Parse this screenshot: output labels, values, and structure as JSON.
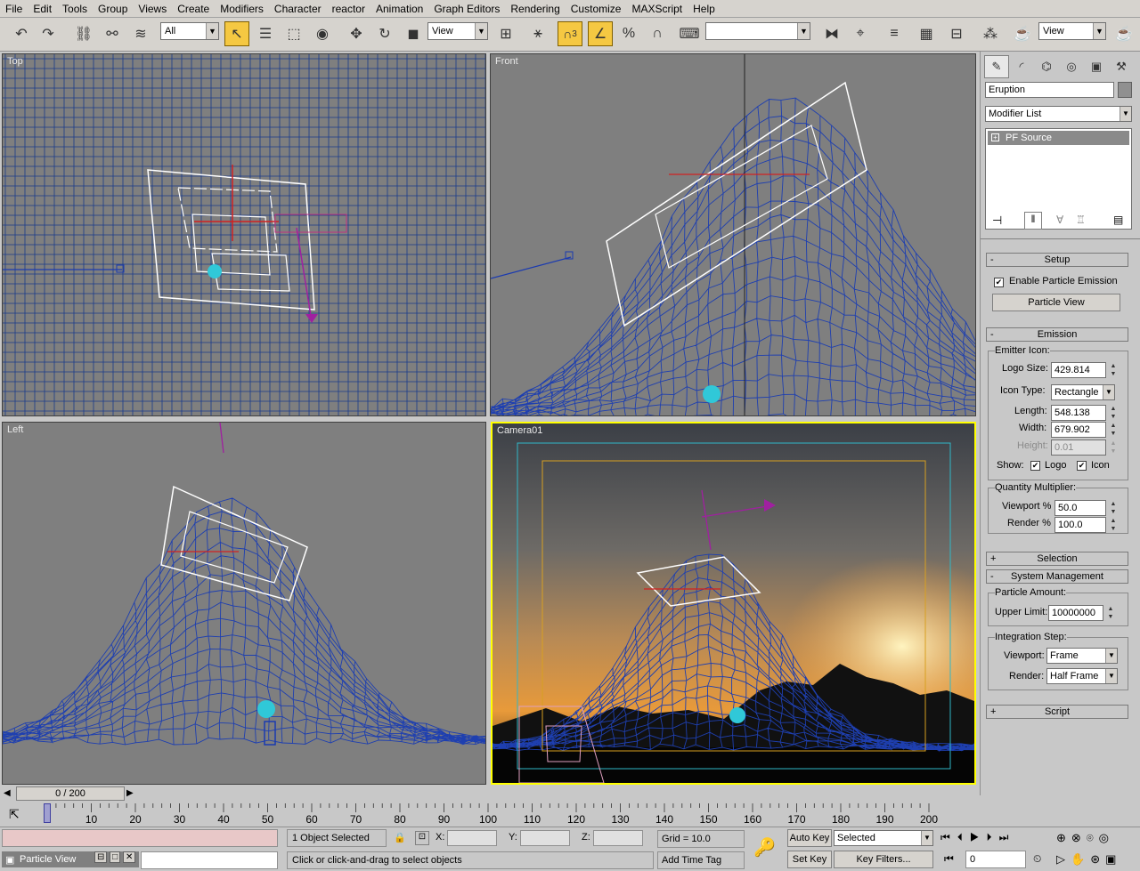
{
  "menu": [
    "File",
    "Edit",
    "Tools",
    "Group",
    "Views",
    "Create",
    "Modifiers",
    "Character",
    "reactor",
    "Animation",
    "Graph Editors",
    "Rendering",
    "Customize",
    "MAXScript",
    "Help"
  ],
  "toolbar": {
    "selection_filter": "All",
    "ref_coord": "View",
    "named_selection": "",
    "render_view": "View",
    "snap_count": "3"
  },
  "viewports": {
    "top": "Top",
    "front": "Front",
    "left": "Left",
    "camera": "Camera01"
  },
  "colors": {
    "viewport_bg": "#7f7f7f",
    "grid_blue": "#1a3a8a",
    "active_border": "#ffff00",
    "accent_yellow": "#f5c842"
  },
  "command_panel": {
    "object_name": "Eruption",
    "modifier_list": "Modifier List",
    "stack_item": "PF Source",
    "setup": {
      "title": "Setup",
      "enable_emission": "Enable Particle Emission",
      "particle_view_btn": "Particle View"
    },
    "emission": {
      "title": "Emission",
      "emitter_icon": "Emitter Icon:",
      "logo_size_label": "Logo Size:",
      "logo_size": "429.814",
      "icon_type_label": "Icon Type:",
      "icon_type": "Rectangle",
      "length_label": "Length:",
      "length": "548.138",
      "width_label": "Width:",
      "width": "679.902",
      "height_label": "Height:",
      "height": "0.01",
      "show_label": "Show:",
      "logo": "Logo",
      "icon": "Icon",
      "quantity_multiplier": "Quantity Multiplier:",
      "viewport_label": "Viewport %",
      "viewport_pct": "50.0",
      "render_label": "Render %",
      "render_pct": "100.0"
    },
    "selection": {
      "title": "Selection"
    },
    "system_management": {
      "title": "System Management",
      "particle_amount": "Particle Amount:",
      "upper_limit_label": "Upper Limit:",
      "upper_limit": "10000000",
      "integration_step": "Integration Step:",
      "viewport_label": "Viewport:",
      "viewport": "Frame",
      "render_label": "Render:",
      "render": "Half Frame"
    },
    "script": {
      "title": "Script"
    }
  },
  "timeline": {
    "slider": "0 / 200",
    "ticks": [
      "0",
      "10",
      "20",
      "30",
      "40",
      "50",
      "60",
      "70",
      "80",
      "90",
      "100",
      "110",
      "120",
      "130",
      "140",
      "150",
      "160",
      "170",
      "180",
      "190",
      "200"
    ]
  },
  "status": {
    "particle_view_title": "Particle View",
    "selected_count": "1 Object Selected",
    "prompt": "Click or click-and-drag to select objects",
    "x_label": "X:",
    "y_label": "Y:",
    "z_label": "Z:",
    "grid": "Grid = 10.0",
    "add_time_tag": "Add Time Tag",
    "auto_key": "Auto Key",
    "set_key": "Set Key",
    "selected": "Selected",
    "key_filters": "Key Filters...",
    "frame": "0"
  }
}
